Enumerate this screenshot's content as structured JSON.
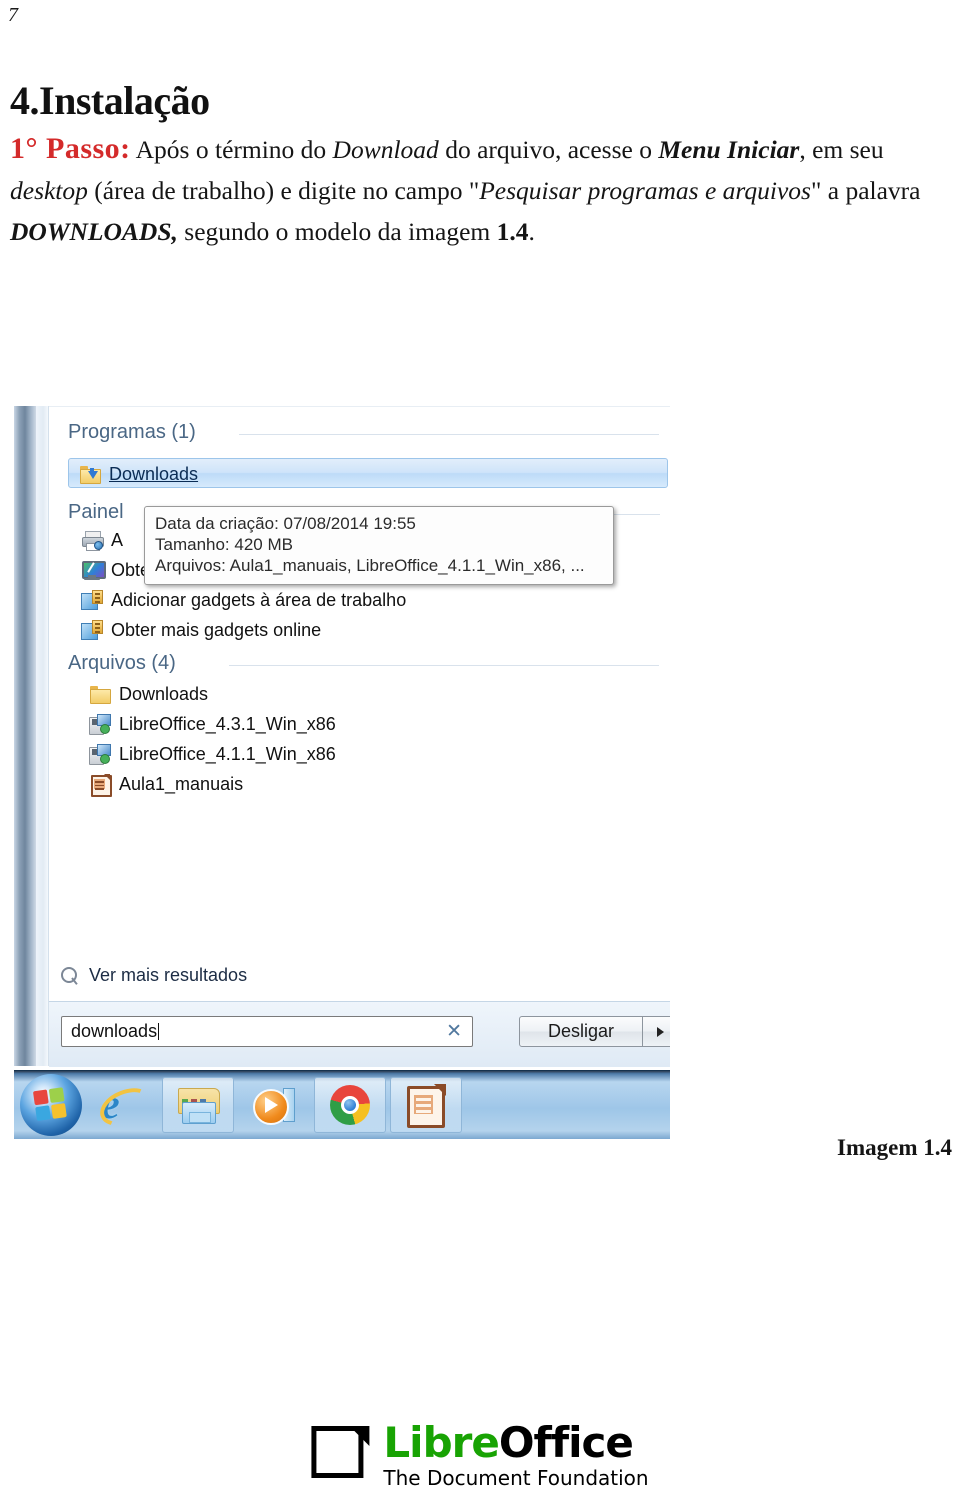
{
  "document": {
    "page_number": "7",
    "heading": "4.Instalação",
    "body": {
      "step_label": "1° Passo:",
      "seg1": " Após o término do ",
      "download_word": "Download",
      "seg2": " do arquivo, acesse o ",
      "menu_iniciar": "Menu Iniciar",
      "seg3": ", em seu ",
      "desktop_word": "desktop",
      "seg4": " (área de trabalho) e digite no campo \"",
      "search_field_name": "Pesquisar programas e arquivos",
      "seg5": "\" a palavra ",
      "downloads_word": "DOWNLOADS,",
      "seg6": " segundo o modelo da imagem ",
      "image_ref": "1.4",
      "seg7": "."
    },
    "figure_caption": "Imagem 1.4",
    "accent_color": "#d42a2a"
  },
  "screenshot": {
    "groups": [
      {
        "title": "Programas (1)"
      },
      {
        "title": "Painel"
      },
      {
        "title": "Arquivos (4)"
      }
    ],
    "programs": [
      {
        "label": "Downloads",
        "icon": "folder-download-icon",
        "selected": true
      }
    ],
    "control_panel": [
      {
        "label": "A",
        "icon": "printer-fax-icon"
      },
      {
        "label": "Obter mais temas online",
        "icon": "display-theme-icon"
      },
      {
        "label": "Adicionar gadgets à área de trabalho",
        "icon": "gadget-icon"
      },
      {
        "label": "Obter mais gadgets online",
        "icon": "gadget-icon"
      }
    ],
    "files": [
      {
        "label": "Downloads",
        "icon": "folder-icon"
      },
      {
        "label": "LibreOffice_4.3.1_Win_x86",
        "icon": "installer-icon"
      },
      {
        "label": "LibreOffice_4.1.1_Win_x86",
        "icon": "installer-icon"
      },
      {
        "label": "Aula1_manuais",
        "icon": "libreoffice-doc-icon"
      }
    ],
    "tooltip": {
      "line1": "Data da criação: 07/08/2014 19:55",
      "line2": "Tamanho: 420 MB",
      "line3": "Arquivos: Aula1_manuais, LibreOffice_4.1.1_Win_x86, ..."
    },
    "see_more": "Ver mais resultados",
    "search": {
      "value": "downloads",
      "placeholder": "Pesquisar programas e arquivos",
      "clear_glyph": "✕"
    },
    "shutdown": {
      "label": "Desligar"
    },
    "taskbar": [
      {
        "name": "start-orb"
      },
      {
        "name": "internet-explorer"
      },
      {
        "name": "windows-explorer"
      },
      {
        "name": "windows-media-player"
      },
      {
        "name": "google-chrome"
      },
      {
        "name": "libreoffice"
      }
    ]
  },
  "footer_logo": {
    "name_part1": "Libre",
    "name_part2": "Office",
    "tagline": "The Document Foundation",
    "green": "#18a303"
  }
}
